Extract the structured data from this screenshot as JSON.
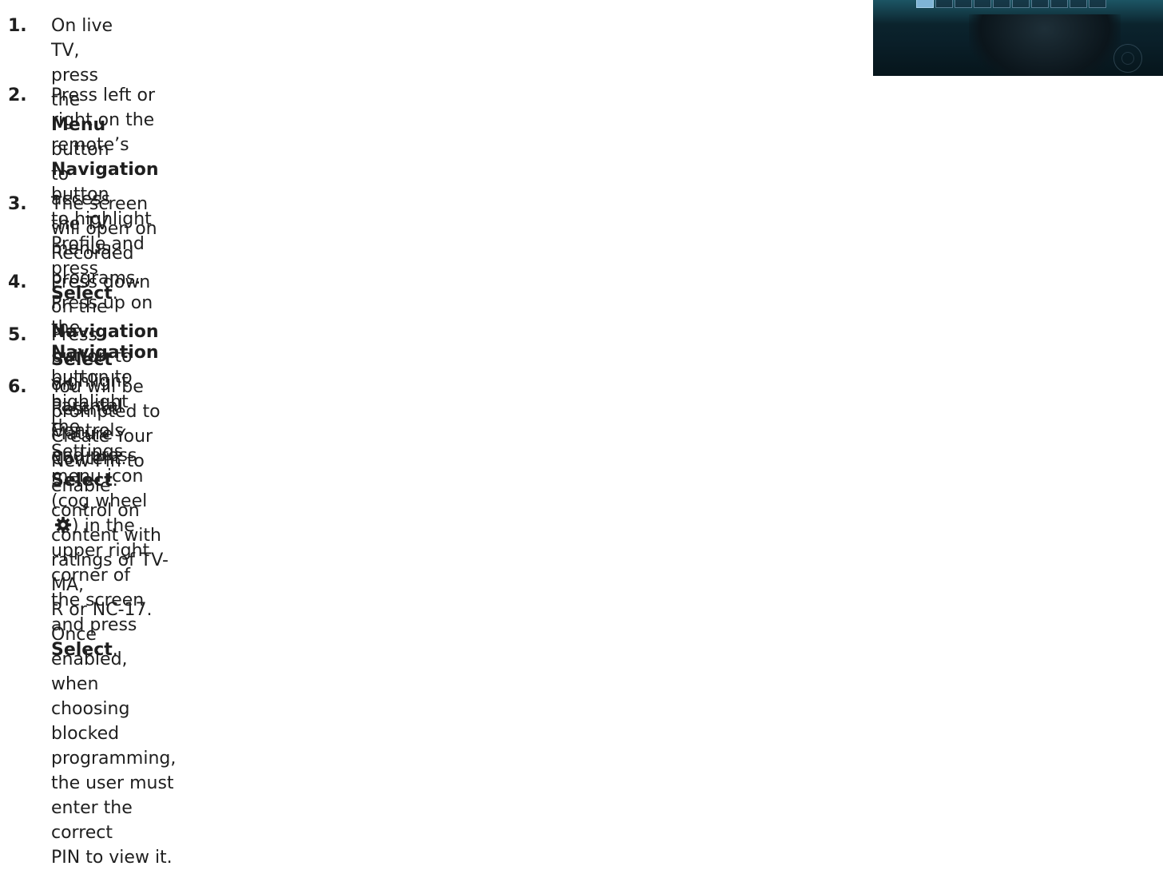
{
  "steps": [
    {
      "number": "1.",
      "parts": [
        {
          "t": "On live TV, press the "
        },
        {
          "b": "Menu"
        },
        {
          "t": " button to access\nthe TV menus."
        }
      ]
    },
    {
      "number": "2.",
      "parts": [
        {
          "t": "Press left or right on the remote’s "
        },
        {
          "b": "Navigation"
        },
        {
          "t": " button\nto highlight Profile and press "
        },
        {
          "b": "Select"
        },
        {
          "t": "."
        }
      ]
    },
    {
      "number": "3.",
      "parts": [
        {
          "t": "The screen will open on Recorded programs. Press up on the "
        },
        {
          "b": "Navigation"
        },
        {
          "t": " button to highlight the\nSettings menu icon (cog wheel "
        },
        {
          "icon": "cog-icon"
        },
        {
          "t": ") in the upper right corner of the screen and press "
        },
        {
          "b": "Select"
        },
        {
          "t": "."
        }
      ]
    },
    {
      "number": "4.",
      "parts": [
        {
          "t": "Press down on the "
        },
        {
          "b": "Navigation"
        },
        {
          "t": " button to highlight Parental Controls and press "
        },
        {
          "b": "Select"
        },
        {
          "t": "."
        }
      ]
    },
    {
      "number": "5.",
      "parts": [
        {
          "t": "Press "
        },
        {
          "b": "Select"
        },
        {
          "t": " on Restrict Mature Content."
        }
      ]
    },
    {
      "number": "6.",
      "parts": [
        {
          "t": "You will be prompted to Create Your New Pin to enable control on content with ratings of TV-MA,\nR or NC-17. Once enabled, when choosing blocked programming, the user must enter the correct\nPIN to view it."
        }
      ]
    }
  ],
  "icons": {
    "cog": "cog-icon"
  },
  "colors": {
    "text": "#1f1f1f",
    "tv_highlight": "#7fb4d6"
  }
}
